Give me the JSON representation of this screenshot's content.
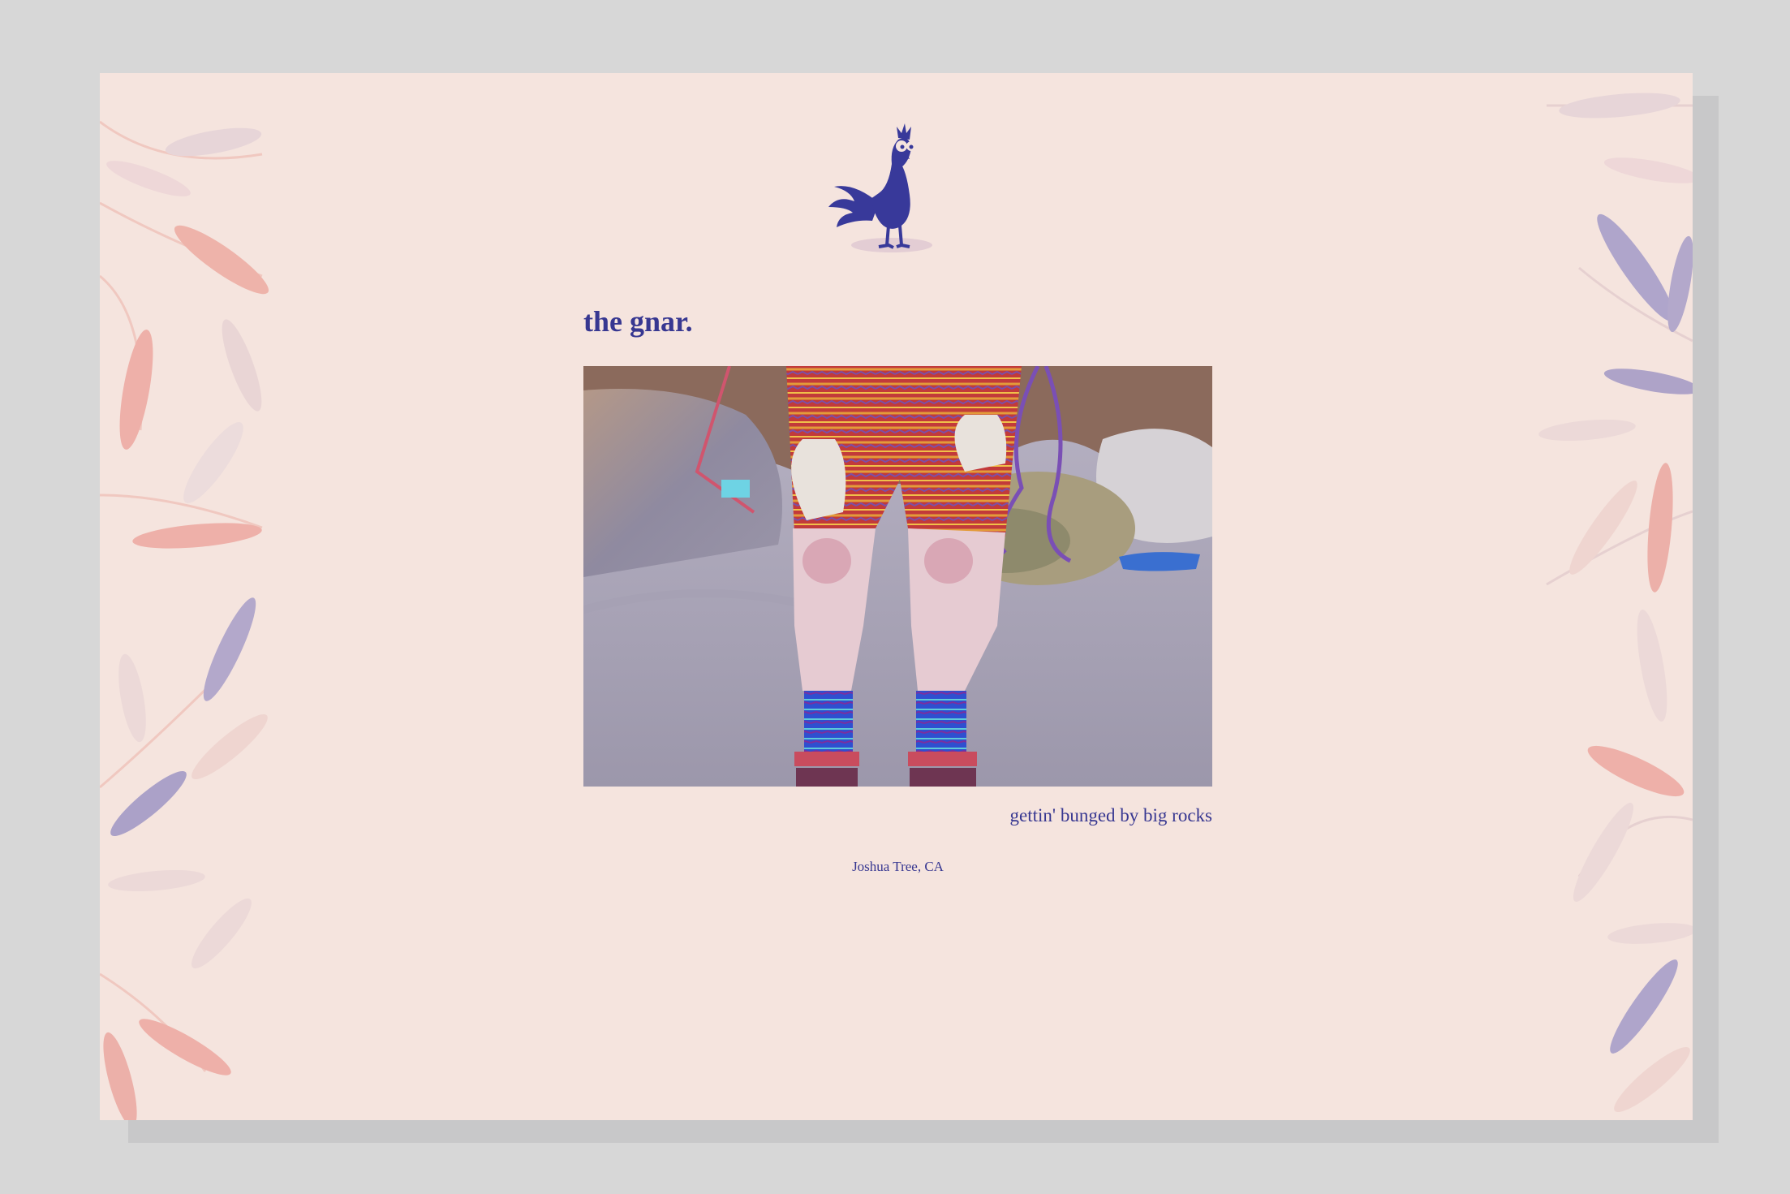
{
  "post": {
    "title": "the gnar.",
    "caption": "gettin' bunged by big rocks",
    "location": "Joshua Tree, CA"
  },
  "logo": {
    "icon": "rooster-icon"
  },
  "photo": {
    "subject": "climber-legs-photo"
  },
  "colors": {
    "background": "#f5e4de",
    "accent": "#373791",
    "leaf_pink": "#ecaaa6",
    "leaf_lavender": "#a9a0c6"
  }
}
